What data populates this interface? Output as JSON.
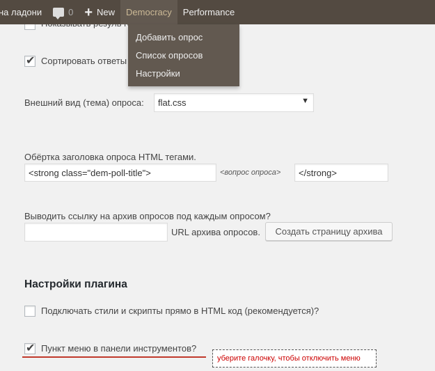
{
  "adminbar": {
    "site_name": "на ладони",
    "comments_count": "0",
    "new_label": "New",
    "democracy_label": "Democracy",
    "performance_label": "Performance"
  },
  "dropdown": {
    "items": [
      "Добавить опрос",
      "Список опросов",
      "Настройки"
    ]
  },
  "options": {
    "show_results_label": "Показывать резуль                           голосов.",
    "sort_answers_label": "Сортировать ответы",
    "theme_label": "Внешний вид (тема) опроса:",
    "theme_value": "flat.css",
    "wrapper_label": "Обёртка заголовка опроса HTML тегами.",
    "wrapper_open_value": "<strong class=\"dem-poll-title\">",
    "wrapper_middle": "<вопрос опроса>",
    "wrapper_close_value": "</strong>",
    "archive_label": "Выводить ссылку на архив опросов под каждым опросом?",
    "archive_url_value": "",
    "archive_url_caption": "URL архива опросов.",
    "archive_button": "Создать страницу архива"
  },
  "plugin_settings": {
    "heading": "Настройки плагина",
    "inline_styles_label": "Подключать стили и скрипты прямо в HTML код (рекомендуется)?",
    "toolbar_menu_label": "Пункт меню в панели инструментов?",
    "annotation": "уберите галочку, чтобы отключить меню"
  },
  "colors": {
    "adminbar_bg": "#534a41",
    "dropdown_bg": "#625950",
    "active_text": "#cbb996",
    "annotation_red": "#c00000"
  }
}
